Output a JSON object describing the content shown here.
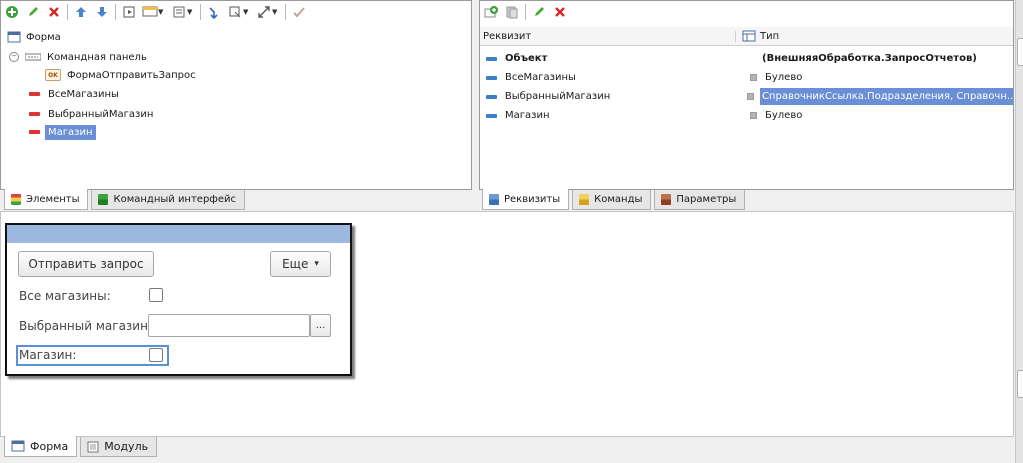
{
  "left_panel": {
    "tree": [
      {
        "label": "Форма",
        "icon": "form-icon"
      },
      {
        "label": "Командная панель",
        "icon": "command-panel-icon"
      },
      {
        "label": "ФормаОтправитьЗапрос",
        "icon": "ok-button-icon",
        "badge": "OK"
      },
      {
        "label": "ВсеМагазины",
        "icon": "attribute-icon"
      },
      {
        "label": "ВыбранныйМагазин",
        "icon": "attribute-icon"
      },
      {
        "label": "Магазин",
        "icon": "attribute-icon"
      }
    ],
    "tabs": [
      "Элементы",
      "Командный интерфейс"
    ]
  },
  "right_panel": {
    "col_attr": "Реквизит",
    "col_type": "Тип",
    "rows": [
      {
        "name": "Объект",
        "type": "(ВнешняяОбработка.ЗапросОтчетов)"
      },
      {
        "name": "ВсеМагазины",
        "type": "Булево"
      },
      {
        "name": "ВыбранныйМагазин",
        "type": "СправочникСсылка.Подразделения, Справочн..."
      },
      {
        "name": "Магазин",
        "type": "Булево"
      }
    ],
    "tabs": [
      "Реквизиты",
      "Команды",
      "Параметры"
    ]
  },
  "preview": {
    "send_button": "Отправить запрос",
    "more_button": "Еще",
    "more_arrow": "▾",
    "all_stores_label": "Все магазины:",
    "selected_store_label": "Выбранный магазин:",
    "select_button": "...",
    "store_label": "Магазин:"
  },
  "bottom_tabs": [
    "Форма",
    "Модуль"
  ],
  "colors": {
    "selection": "#6b8fd6",
    "attribute": "#e03333",
    "form_header": "#9db8de"
  }
}
